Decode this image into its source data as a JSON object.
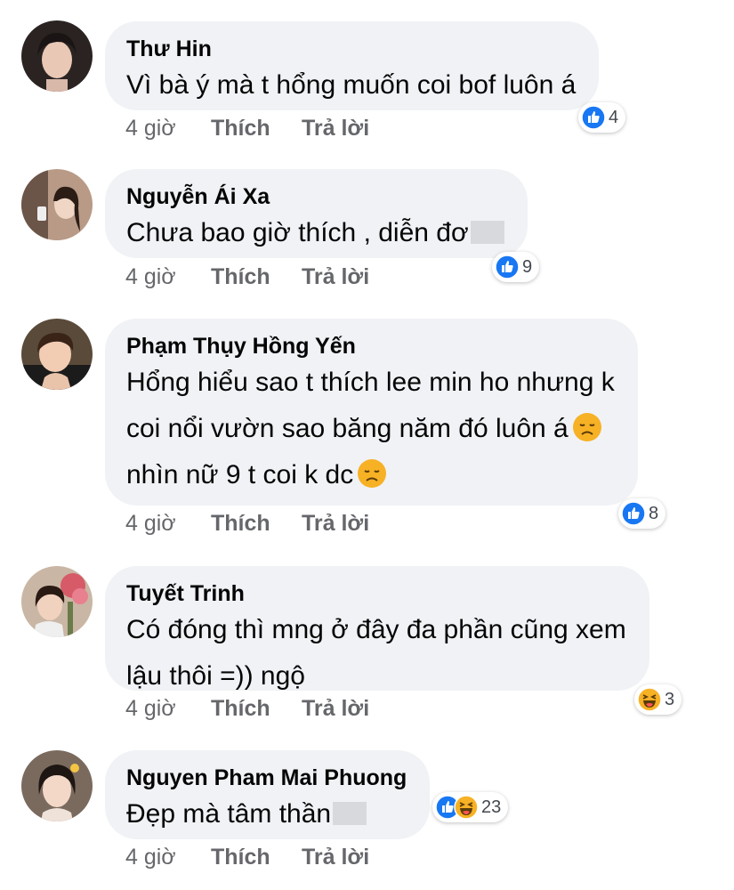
{
  "colors": {
    "bubble": "#f0f2f5",
    "like_blue": "#1877f2",
    "meta_gray": "#65676b",
    "haha_yellow": "#f7b125"
  },
  "comments": [
    {
      "author": "Thư Hin",
      "lines": [
        "Vì bà ý mà t hổng muốn coi bof luôn á"
      ],
      "reactions": [
        "like-icon"
      ],
      "reaction_count": "4",
      "time": "4 giờ",
      "like_label": "Thích",
      "reply_label": "Trả lời"
    },
    {
      "author": "Nguyễn Ái Xa",
      "lines": [
        "Chưa bao giờ thích , diễn đơ"
      ],
      "reactions": [
        "like-icon"
      ],
      "reaction_count": "9",
      "time": "4 giờ",
      "like_label": "Thích",
      "reply_label": "Trả lời"
    },
    {
      "author": "Phạm Thụy Hồng Yến",
      "lines": [
        "Hổng hiểu sao t thích lee min ho nhưng k",
        "coi nổi vườn sao băng năm đó luôn á",
        "nhìn nữ 9 t coi k dc"
      ],
      "reactions": [
        "like-icon"
      ],
      "reaction_count": "8",
      "time": "4 giờ",
      "like_label": "Thích",
      "reply_label": "Trả lời"
    },
    {
      "author": "Tuyết Trinh",
      "lines": [
        "Có đóng thì mng ở đây đa phần  cũng xem",
        "lậu thôi =)) ngộ"
      ],
      "reactions": [
        "haha-icon"
      ],
      "reaction_count": "3",
      "time": "4 giờ",
      "like_label": "Thích",
      "reply_label": "Trả lời"
    },
    {
      "author": "Nguyen Pham Mai Phuong",
      "lines": [
        "Đẹp mà tâm thần"
      ],
      "reactions": [
        "like-icon",
        "haha-icon"
      ],
      "reaction_count": "23",
      "time": "4 giờ",
      "like_label": "Thích",
      "reply_label": "Trả lời"
    }
  ]
}
